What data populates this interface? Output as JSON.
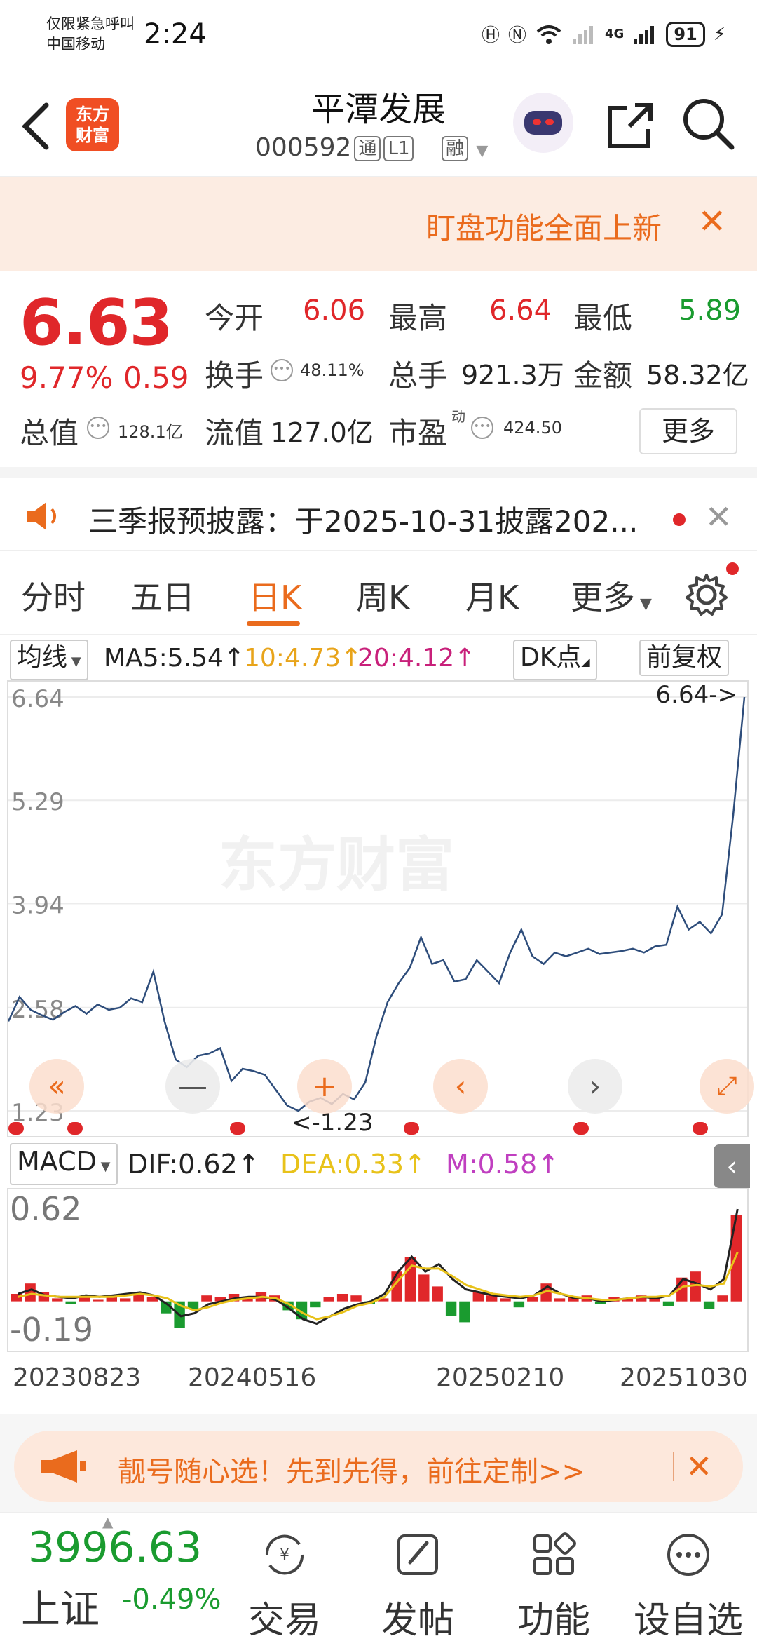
{
  "status_bar": {
    "carrier_line1": "仅限紧急呼叫",
    "carrier_line2": "中国移动",
    "time": "2:24",
    "network": "4G",
    "battery": "91"
  },
  "header": {
    "logo_line1": "东方",
    "logo_line2": "财富",
    "stock_name": "平潭发展",
    "stock_code": "000592",
    "tag_tong": "通",
    "tag_level": "L1",
    "tag_rong": "融"
  },
  "notice": {
    "text": "盯盘功能全面上新",
    "close": "✕"
  },
  "quote": {
    "price": "6.63",
    "change_pct": "9.77%",
    "change": "0.59",
    "open_label": "今开",
    "open": "6.06",
    "high_label": "最高",
    "high": "6.64",
    "low_label": "最低",
    "low": "5.89",
    "turnover_label": "换手",
    "turnover": "48.11%",
    "volume_label": "总手",
    "volume": "921.3万",
    "amount_label": "金额",
    "amount": "58.32亿",
    "mktcap_label": "总值",
    "mktcap": "128.1亿",
    "float_label": "流值",
    "float": "127.0亿",
    "pe_label": "市盈",
    "pe_sup": "动",
    "pe": "424.50",
    "more": "更多"
  },
  "announce": {
    "text": "三季报预披露：于2025-10-31披露202..."
  },
  "tabs": [
    "分时",
    "五日",
    "日K",
    "周K",
    "月K",
    "更多"
  ],
  "active_tab": "日K",
  "indicator": {
    "ma_select": "均线",
    "ma5": "MA5:5.54↑",
    "ma10": "10:4.73↑",
    "ma20": "20:4.12↑",
    "dk": "DK点",
    "adjust": "前复权"
  },
  "colors": {
    "accent": "#ea6b1d",
    "up": "#e0272a",
    "down": "#1a9b2f",
    "line": "#2e4d7b",
    "dea": "#e8c21a",
    "macd_m": "#c03fc0"
  },
  "chart_data": [
    {
      "type": "line",
      "title": "",
      "watermark": "东方财富",
      "y_ticks": [
        "6.64",
        "5.29",
        "3.94",
        "2.58",
        "1.23"
      ],
      "ylim": [
        1.23,
        6.64
      ],
      "max_label": "6.64->",
      "min_label": "<-1.23",
      "x": [
        "20230823",
        "20240516",
        "20250210",
        "20251030"
      ],
      "series": [
        {
          "values": [
            2.4,
            2.72,
            2.55,
            2.48,
            2.42,
            2.52,
            2.6,
            2.5,
            2.62,
            2.55,
            2.58,
            2.7,
            2.65,
            3.05,
            2.4,
            1.9,
            1.8,
            1.95,
            1.98,
            2.05,
            1.62,
            1.78,
            1.75,
            1.7,
            1.5,
            1.3,
            1.23,
            1.35,
            1.4,
            1.32,
            1.45,
            1.38,
            1.6,
            2.2,
            2.65,
            2.9,
            3.1,
            3.5,
            3.15,
            3.2,
            2.92,
            2.95,
            3.2,
            3.05,
            2.9,
            3.3,
            3.6,
            3.25,
            3.15,
            3.3,
            3.25,
            3.3,
            3.35,
            3.28,
            3.3,
            3.32,
            3.35,
            3.3,
            3.38,
            3.4,
            3.9,
            3.6,
            3.7,
            3.55,
            3.8,
            5.1,
            6.64
          ]
        }
      ]
    },
    {
      "type": "bar",
      "title": "",
      "indicator_select": "MACD",
      "dif": "DIF:0.62↑",
      "dea": "DEA:0.33↑",
      "m": "M:0.58↑",
      "y_ticks": [
        "0.62",
        "-0.19"
      ],
      "ylim": [
        -0.19,
        0.62
      ],
      "series": [
        {
          "name": "M",
          "values": [
            0.05,
            0.12,
            0.06,
            0.02,
            -0.02,
            0.03,
            0.01,
            0.04,
            0.02,
            0.06,
            0.03,
            -0.08,
            -0.18,
            -0.05,
            0.04,
            0.03,
            0.05,
            0.02,
            0.06,
            0.04,
            -0.06,
            -0.12,
            -0.04,
            0.03,
            0.05,
            0.04,
            -0.02,
            0.02,
            0.2,
            0.3,
            0.18,
            0.1,
            -0.1,
            -0.14,
            0.06,
            0.04,
            0.02,
            -0.04,
            0.03,
            0.12,
            0.02,
            0.03,
            0.04,
            -0.02,
            0.03,
            0.02,
            0.04,
            0.03,
            -0.03,
            0.16,
            0.2,
            -0.05,
            0.04,
            0.58
          ]
        },
        {
          "name": "DIF",
          "values": [
            0.05,
            0.08,
            0.04,
            0.03,
            0.02,
            0.04,
            0.03,
            0.04,
            0.05,
            0.06,
            0.04,
            -0.02,
            -0.1,
            -0.08,
            -0.02,
            0.0,
            0.02,
            0.03,
            0.03,
            0.01,
            -0.05,
            -0.12,
            -0.15,
            -0.1,
            -0.05,
            -0.02,
            0.0,
            0.05,
            0.2,
            0.3,
            0.2,
            0.25,
            0.15,
            0.08,
            0.06,
            0.04,
            0.03,
            0.02,
            0.04,
            0.1,
            0.05,
            0.02,
            0.02,
            0.0,
            0.01,
            0.02,
            0.03,
            0.02,
            0.04,
            0.15,
            0.12,
            0.08,
            0.15,
            0.62
          ]
        },
        {
          "name": "DEA",
          "values": [
            0.03,
            0.05,
            0.04,
            0.03,
            0.03,
            0.03,
            0.03,
            0.03,
            0.04,
            0.05,
            0.04,
            0.02,
            -0.03,
            -0.06,
            -0.04,
            -0.01,
            0.01,
            0.02,
            0.03,
            0.02,
            -0.02,
            -0.08,
            -0.12,
            -0.1,
            -0.07,
            -0.03,
            -0.01,
            0.03,
            0.14,
            0.24,
            0.22,
            0.22,
            0.17,
            0.11,
            0.08,
            0.05,
            0.04,
            0.03,
            0.04,
            0.07,
            0.05,
            0.03,
            0.02,
            0.01,
            0.01,
            0.02,
            0.03,
            0.03,
            0.04,
            0.1,
            0.11,
            0.1,
            0.12,
            0.33
          ]
        }
      ]
    }
  ],
  "x_dates": [
    "20230823",
    "20240516",
    "20250210",
    "20251030"
  ],
  "promo": {
    "text": "靓号随心选！先到先得，前往定制>>"
  },
  "bottom_bar": {
    "index_value": "3996.63",
    "index_name": "上证",
    "index_change": "-0.49%",
    "items": [
      "交易",
      "发帖",
      "功能",
      "设自选"
    ]
  }
}
